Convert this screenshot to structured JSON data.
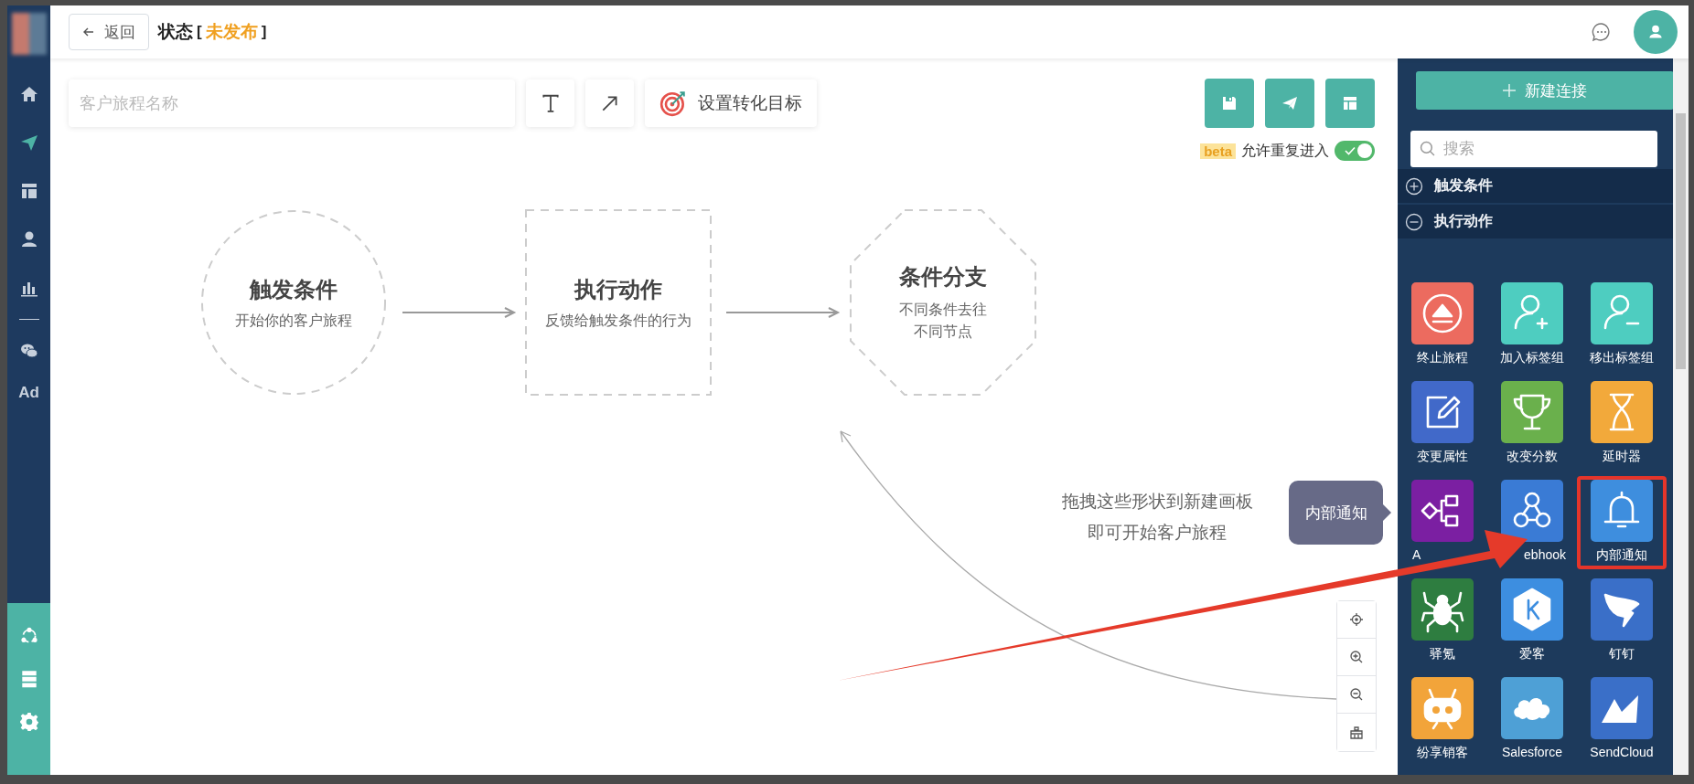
{
  "header": {
    "back_button": "返回",
    "title": "状态",
    "status_open": "[",
    "status": "未发布",
    "status_close": "]"
  },
  "sidebar": {
    "ad_label": "Ad"
  },
  "toolbar": {
    "name_field": {
      "placeholder": "客户旅程名称"
    },
    "goal_button": "设置转化目标"
  },
  "repeat_entry": {
    "badge": "beta",
    "label": "允许重复进入",
    "on": true
  },
  "canvas": {
    "nodes": [
      {
        "kind": "circle",
        "title": "触发条件",
        "subtitle": "开始你的客户旅程"
      },
      {
        "kind": "square",
        "title": "执行动作",
        "subtitle": "反馈给触发条件的行为"
      },
      {
        "kind": "octagon",
        "title": "条件分支",
        "subtitle": "不同条件去往不同节点"
      }
    ],
    "hint": [
      "拖拽这些形状到新建画板",
      "即可开始客户旅程"
    ],
    "drag_tooltip": "内部通知"
  },
  "panel": {
    "new_button": "新建连接",
    "search": {
      "placeholder": "搜索"
    },
    "sections": [
      {
        "label": "触发条件",
        "expanded": false
      },
      {
        "label": "执行动作",
        "expanded": true
      }
    ],
    "items": [
      {
        "label": "终止旅程",
        "kind": "eject",
        "color": "#ec6b5f",
        "highlighted": false
      },
      {
        "label": "加入标签组",
        "kind": "user-plus",
        "color": "#4ecdc0",
        "highlighted": false
      },
      {
        "label": "移出标签组",
        "kind": "user-minus",
        "color": "#4ecdc0",
        "highlighted": false
      },
      {
        "label": "变更属性",
        "kind": "edit",
        "color": "#4169c9",
        "highlighted": false
      },
      {
        "label": "改变分数",
        "kind": "trophy",
        "color": "#6ab04c",
        "highlighted": false
      },
      {
        "label": "延时器",
        "kind": "hourglass",
        "color": "#f2a93b",
        "highlighted": false
      },
      {
        "label": "A",
        "kind": "flow",
        "color": "#7b1fa2",
        "highlighted": false
      },
      {
        "label": "ebhook",
        "kind": "webhook",
        "color": "#3a7bd5",
        "highlighted": false
      },
      {
        "label": "内部通知",
        "kind": "bell",
        "color": "#3e8ede",
        "highlighted": true
      },
      {
        "label": "驿氪",
        "kind": "spider",
        "color": "#2e7d40",
        "highlighted": false
      },
      {
        "label": "爱客",
        "kind": "hexagon",
        "color": "#3d8ee0",
        "highlighted": false
      },
      {
        "label": "钉钉",
        "kind": "wing",
        "color": "#3a6fc8",
        "highlighted": false
      },
      {
        "label": "纷享销客",
        "kind": "robot",
        "color": "#f2a43a",
        "highlighted": false
      },
      {
        "label": "Salesforce",
        "kind": "cloud",
        "color": "#4ea0d6",
        "highlighted": false
      },
      {
        "label": "SendCloud",
        "kind": "peaks",
        "color": "#3a6fc8",
        "highlighted": false
      }
    ]
  }
}
